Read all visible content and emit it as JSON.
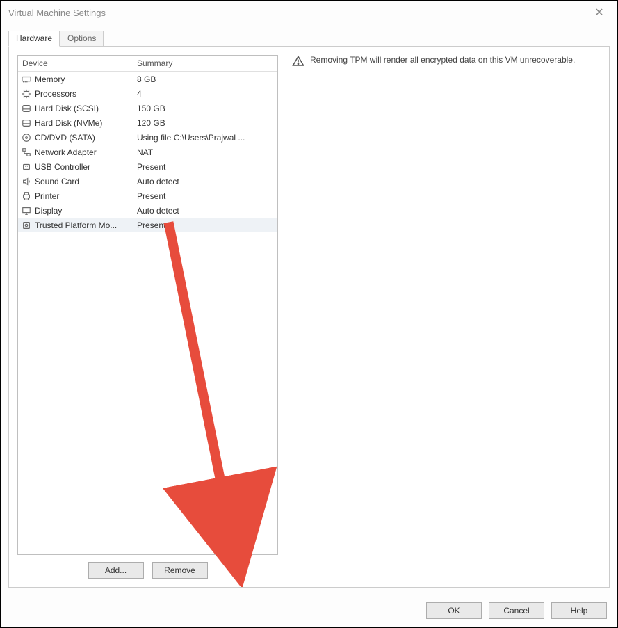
{
  "window": {
    "title": "Virtual Machine Settings"
  },
  "tabs": [
    {
      "label": "Hardware",
      "active": true
    },
    {
      "label": "Options",
      "active": false
    }
  ],
  "device_list": {
    "headers": {
      "device": "Device",
      "summary": "Summary"
    },
    "rows": [
      {
        "icon": "memory-icon",
        "device": "Memory",
        "summary": "8 GB"
      },
      {
        "icon": "cpu-icon",
        "device": "Processors",
        "summary": "4"
      },
      {
        "icon": "hdd-icon",
        "device": "Hard Disk (SCSI)",
        "summary": "150 GB"
      },
      {
        "icon": "hdd-icon",
        "device": "Hard Disk (NVMe)",
        "summary": "120 GB"
      },
      {
        "icon": "disc-icon",
        "device": "CD/DVD (SATA)",
        "summary": "Using file C:\\Users\\Prajwal ..."
      },
      {
        "icon": "network-icon",
        "device": "Network Adapter",
        "summary": "NAT"
      },
      {
        "icon": "usb-icon",
        "device": "USB Controller",
        "summary": "Present"
      },
      {
        "icon": "sound-icon",
        "device": "Sound Card",
        "summary": "Auto detect"
      },
      {
        "icon": "printer-icon",
        "device": "Printer",
        "summary": "Present"
      },
      {
        "icon": "display-icon",
        "device": "Display",
        "summary": "Auto detect"
      },
      {
        "icon": "tpm-icon",
        "device": "Trusted Platform Mo...",
        "summary": "Present",
        "selected": true
      }
    ]
  },
  "buttons": {
    "add": "Add...",
    "remove": "Remove",
    "ok": "OK",
    "cancel": "Cancel",
    "help": "Help"
  },
  "detail": {
    "warning": "Removing TPM will render all encrypted data on this VM unrecoverable."
  }
}
